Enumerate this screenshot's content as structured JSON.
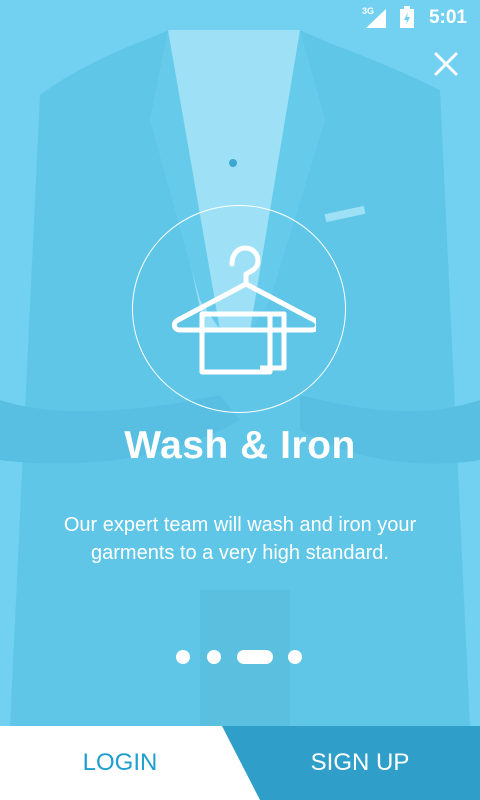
{
  "status_bar": {
    "network": "3G",
    "time": "5:01"
  },
  "icons": {
    "close": "close-icon",
    "feature": "hanger-shirt-icon",
    "signal": "signal-icon",
    "battery": "battery-icon"
  },
  "feature": {
    "title": "Wash & Iron",
    "description": "Our expert team will wash and iron your garments to a very high standard."
  },
  "pager": {
    "count": 4,
    "active_index": 2
  },
  "actions": {
    "login_label": "LOGIN",
    "signup_label": "SIGN UP"
  },
  "colors": {
    "overlay": "#6fd0ef",
    "signup_bg": "#2f9fca",
    "login_text": "#1f9fd0",
    "text_on_overlay": "#ffffff"
  }
}
